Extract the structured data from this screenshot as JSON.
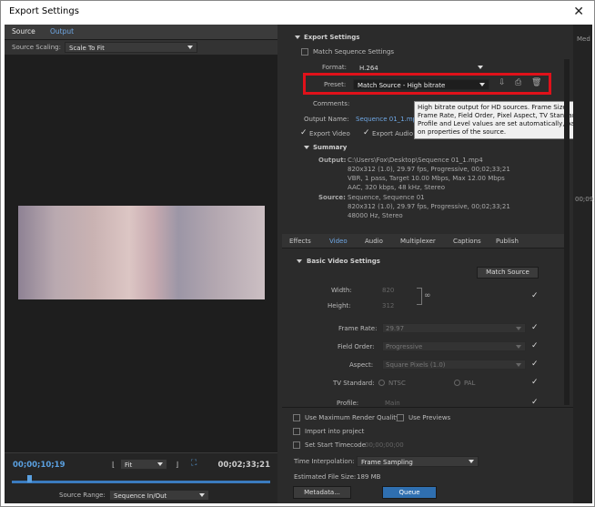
{
  "window": {
    "title": "Export Settings",
    "close_glyph": "✕"
  },
  "left": {
    "tabs": [
      {
        "label": "Source",
        "active": true
      },
      {
        "label": "Output",
        "active": false
      }
    ],
    "source_scaling": {
      "label": "Source Scaling:",
      "value": "Scale To Fit"
    },
    "timecode_current": "00;00;10;19",
    "fit": "Fit",
    "timecode_end": "00;02;33;21",
    "source_range": {
      "label": "Source Range:",
      "value": "Sequence In/Out"
    }
  },
  "export": {
    "header": "Export Settings",
    "match_sequence": "Match Sequence Settings",
    "format_label": "Format:",
    "format_value": "H.264",
    "preset_label": "Preset:",
    "preset_value": "Match Source - High bitrate",
    "comments_label": "Comments:",
    "output_name_label": "Output Name:",
    "output_name_value": "Sequence 01_1.mp4",
    "export_video": "Export Video",
    "export_audio": "Export Audio",
    "tooltip": "High bitrate output for HD sources. Frame Size, Frame Rate, Field Order, Pixel Aspect, TV Standard, Profile and Level values are set automatically, based on properties of the source."
  },
  "summary": {
    "header": "Summary",
    "output_label": "Output:",
    "output_lines": [
      "C:\\Users\\Fox\\Desktop\\Sequence 01_1.mp4",
      "820x312 (1.0), 29.97 fps, Progressive, 00;02;33;21",
      "VBR, 1 pass, Target 10.00 Mbps, Max 12.00 Mbps",
      "AAC, 320 kbps, 48 kHz, Stereo"
    ],
    "source_label": "Source:",
    "source_lines": [
      "Sequence, Sequence 01",
      "820x312 (1.0), 29.97 fps, Progressive, 00;02;33;21",
      "48000 Hz, Stereo"
    ]
  },
  "tabs": [
    {
      "label": "Effects",
      "active": false
    },
    {
      "label": "Video",
      "active": true
    },
    {
      "label": "Audio",
      "active": false
    },
    {
      "label": "Multiplexer",
      "active": false
    },
    {
      "label": "Captions",
      "active": false
    },
    {
      "label": "Publish",
      "active": false
    }
  ],
  "video": {
    "header": "Basic Video Settings",
    "match_source": "Match Source",
    "width_label": "Width:",
    "width_value": "820",
    "height_label": "Height:",
    "height_value": "312",
    "frame_rate_label": "Frame Rate:",
    "frame_rate_value": "29.97",
    "field_order_label": "Field Order:",
    "field_order_value": "Progressive",
    "aspect_label": "Aspect:",
    "aspect_value": "Square Pixels (1.0)",
    "tv_label": "TV Standard:",
    "tv_ntsc": "NTSC",
    "tv_pal": "PAL",
    "profile_label": "Profile:",
    "profile_value": "Main"
  },
  "lower": {
    "max_render": "Use Maximum Render Quality",
    "use_previews": "Use Previews",
    "import_project": "Import into project",
    "set_start_tc": "Set Start Timecode",
    "start_tc_value": "00;00;00;00",
    "interp_label": "Time Interpolation:",
    "interp_value": "Frame Sampling",
    "file_size_label": "Estimated File Size:",
    "file_size_value": "189 MB",
    "metadata_btn": "Metadata...",
    "queue_btn": "Queue"
  },
  "far": {
    "lines": [
      "Med",
      "00;09;0"
    ]
  },
  "colors": {
    "accent": "#3b7bbf",
    "highlight": "#e0111a",
    "link": "#6fa8e6"
  }
}
